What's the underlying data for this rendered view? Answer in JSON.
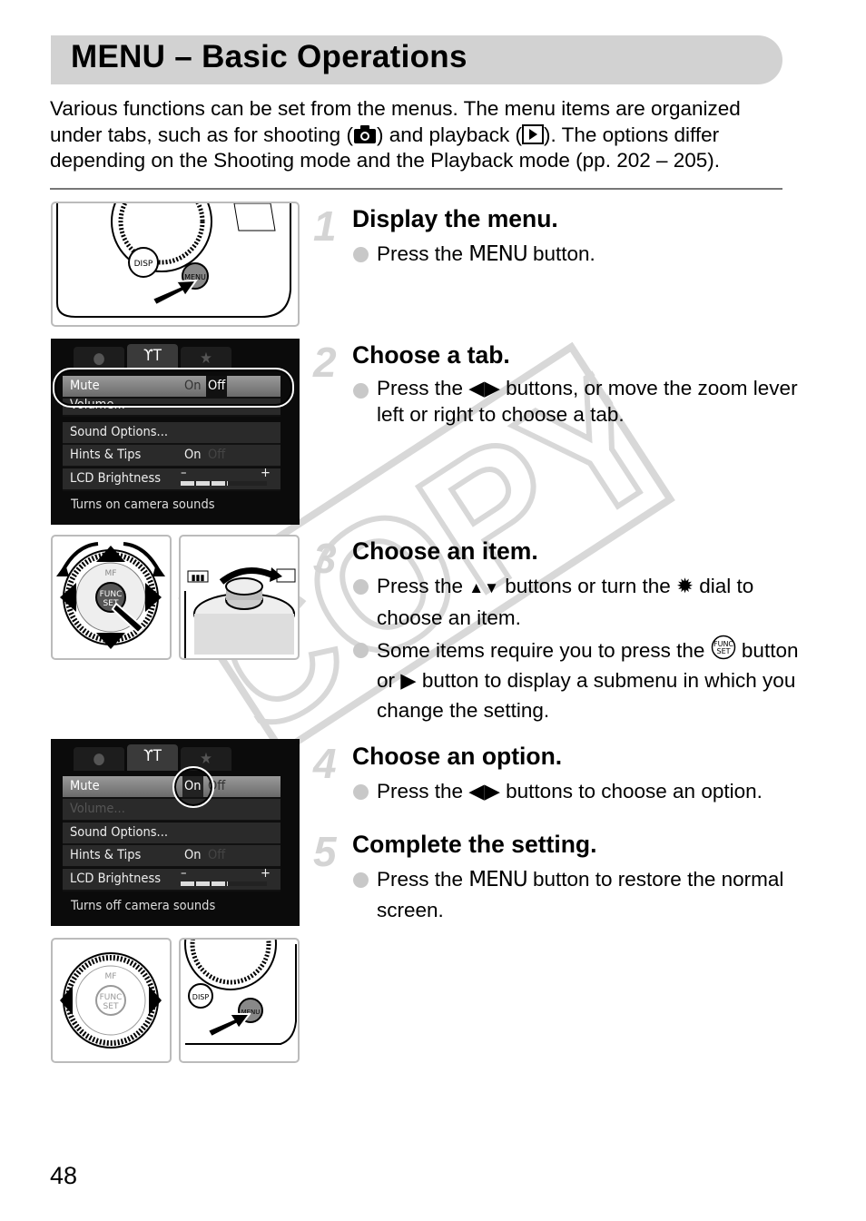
{
  "title": "MENU – Basic Operations",
  "intro": {
    "line1": "Various functions can be set from the menus. The menu items are organized",
    "line2a": "under tabs, such as for shooting (",
    "line2b": ") and playback (",
    "line2c": "). The options differ",
    "line3": "depending on the Shooting mode and the Playback mode (pp. 202 – 205).",
    "icons": [
      "camera-icon",
      "playback-icon"
    ]
  },
  "steps": [
    {
      "number": "1",
      "title": "Display the menu.",
      "bullets": [
        {
          "a": "Press the ",
          "menu": "MENU",
          "b": " button."
        }
      ]
    },
    {
      "number": "2",
      "title": "Choose a tab.",
      "bullets": [
        {
          "a": "Press the ",
          "b": " buttons, or move the zoom lever left or right to choose a tab."
        }
      ]
    },
    {
      "number": "3",
      "title": "Choose an item.",
      "bullets": [
        {
          "a": "Press the ",
          "b": " buttons or turn the ",
          "c": " dial to choose an item."
        },
        {
          "a": "Some items require you to press the ",
          "b": " button or ",
          "c": " button to display a submenu in which you change the setting."
        }
      ]
    },
    {
      "number": "4",
      "title": "Choose an option.",
      "bullets": [
        {
          "a": "Press the ",
          "b": " buttons to choose an option."
        }
      ]
    },
    {
      "number": "5",
      "title": "Complete the setting.",
      "bullets": [
        {
          "a": "Press the ",
          "menu": "MENU",
          "b": " button to restore the normal screen."
        }
      ]
    }
  ],
  "screens": [
    {
      "tabs": [
        "camera-icon",
        "wrench-hammer-icon",
        "star-icon"
      ],
      "items": [
        {
          "label": "Mute",
          "v1": "On",
          "v2": "Off"
        },
        {
          "label": "Volume..."
        },
        {
          "label": "Sound Options..."
        },
        {
          "label": "Hints & Tips",
          "v1": "On",
          "v2": "Off"
        },
        {
          "label": "LCD Brightness",
          "minus": "–",
          "plus": "+"
        }
      ],
      "description": "Turns on camera sounds",
      "brightness_level": 0.55
    },
    {
      "tabs": [
        "camera-icon",
        "wrench-hammer-icon",
        "star-icon"
      ],
      "items": [
        {
          "label": "Mute",
          "v1": "On",
          "v2": "Off"
        },
        {
          "label": "Volume..."
        },
        {
          "label": "Sound Options..."
        },
        {
          "label": "Hints & Tips",
          "v1": "On",
          "v2": "Off"
        },
        {
          "label": "LCD Brightness",
          "minus": "–",
          "plus": "+"
        }
      ],
      "description": "Turns off camera sounds",
      "brightness_level": 0.55
    }
  ],
  "camera_labels": {
    "disp": "DISP",
    "menu": "MENU",
    "set": "SET",
    "func": "FUNC",
    "mf": "MF"
  },
  "watermark": "COPY",
  "page_number": "48"
}
